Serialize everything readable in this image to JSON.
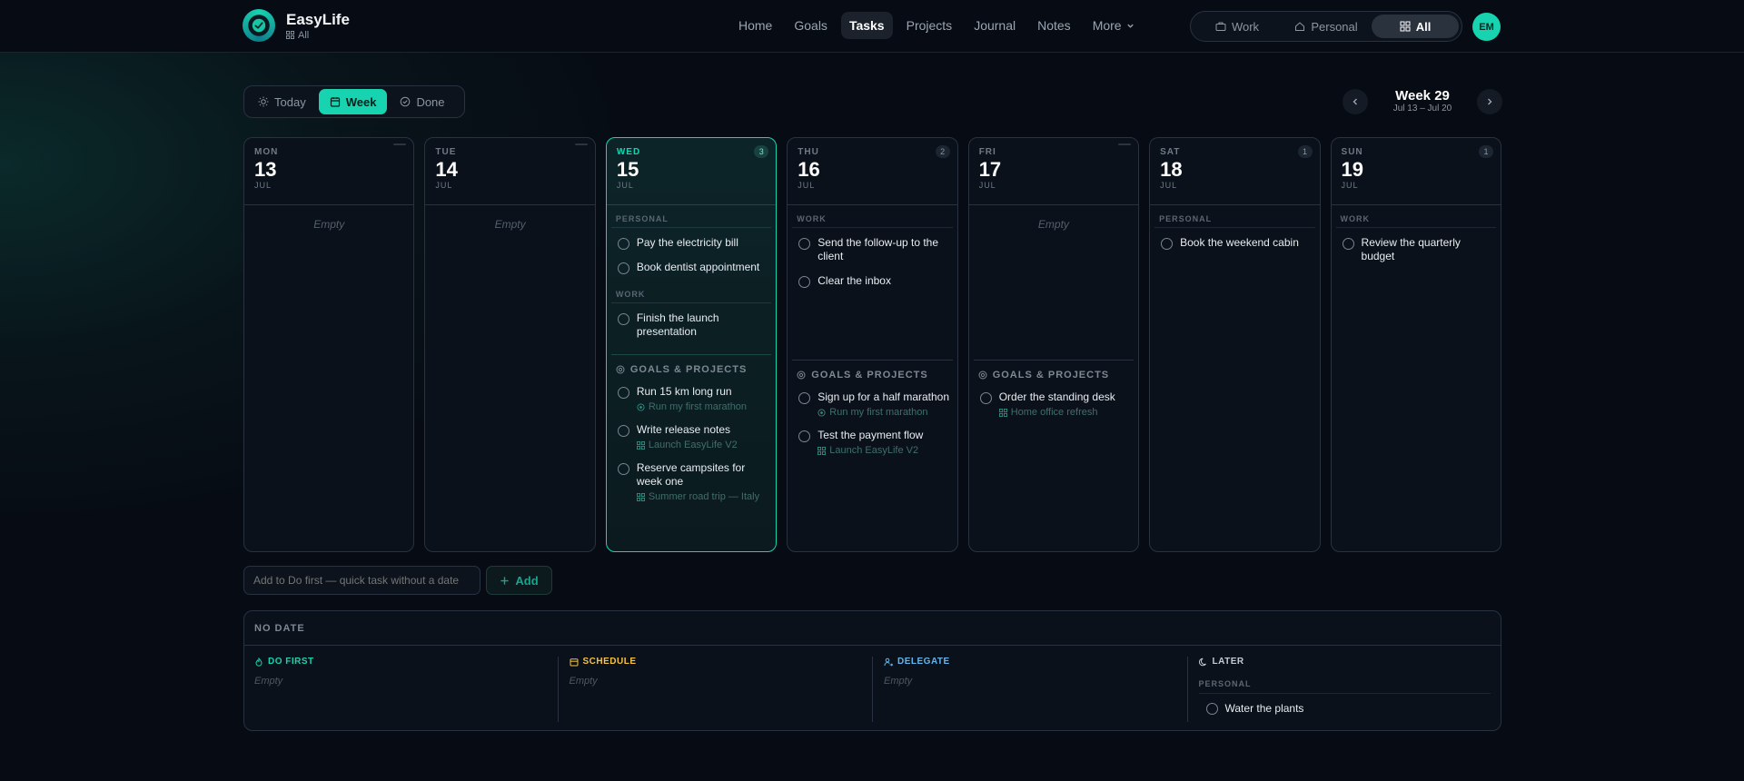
{
  "app": {
    "name": "EasyLife",
    "scope_label": "All"
  },
  "nav": [
    {
      "label": "Home"
    },
    {
      "label": "Goals"
    },
    {
      "label": "Tasks",
      "active": true
    },
    {
      "label": "Projects"
    },
    {
      "label": "Journal"
    },
    {
      "label": "Notes"
    },
    {
      "label": "More"
    }
  ],
  "scope": {
    "work": "Work",
    "personal": "Personal",
    "all": "All"
  },
  "user": {
    "initials": "EM"
  },
  "view": {
    "today": "Today",
    "week": "Week",
    "done": "Done"
  },
  "week": {
    "title": "Week 29",
    "range": "Jul 13 – Jul 20"
  },
  "days": {
    "mon": {
      "dow": "MON",
      "num": "13",
      "mon": "JUL",
      "empty": "Empty"
    },
    "tue": {
      "dow": "TUE",
      "num": "14",
      "mon": "JUL",
      "empty": "Empty"
    },
    "wed": {
      "dow": "WED",
      "num": "15",
      "mon": "JUL",
      "count": "3",
      "personal_label": "PERSONAL",
      "personal": [
        "Pay the electricity bill",
        "Book dentist appointment"
      ],
      "work_label": "WORK",
      "work": [
        "Finish the launch presentation"
      ],
      "gp_label": "GOALS & PROJECTS",
      "gp": [
        {
          "title": "Run 15 km long run",
          "sub": "Run my first marathon"
        },
        {
          "title": "Write release notes",
          "sub": "Launch EasyLife V2"
        },
        {
          "title": "Reserve campsites for week one",
          "sub": "Summer road trip — Italy"
        }
      ]
    },
    "thu": {
      "dow": "THU",
      "num": "16",
      "mon": "JUL",
      "count": "2",
      "work_label": "WORK",
      "work": [
        "Send the follow-up to the client",
        "Clear the inbox"
      ],
      "gp_label": "GOALS & PROJECTS",
      "gp": [
        {
          "title": "Sign up for a half marathon",
          "sub": "Run my first marathon"
        },
        {
          "title": "Test the payment flow",
          "sub": "Launch EasyLife V2"
        }
      ]
    },
    "fri": {
      "dow": "FRI",
      "num": "17",
      "mon": "JUL",
      "empty": "Empty",
      "gp_label": "GOALS & PROJECTS",
      "gp": [
        {
          "title": "Order the standing desk",
          "sub": "Home office refresh"
        }
      ]
    },
    "sat": {
      "dow": "SAT",
      "num": "18",
      "mon": "JUL",
      "count": "1",
      "personal_label": "PERSONAL",
      "personal": [
        "Book the weekend cabin"
      ]
    },
    "sun": {
      "dow": "SUN",
      "num": "19",
      "mon": "JUL",
      "count": "1",
      "work_label": "WORK",
      "work": [
        "Review the quarterly budget"
      ]
    }
  },
  "quick_add": {
    "placeholder": "Add to Do first — quick task without a date",
    "button": "Add"
  },
  "no_date": {
    "title": "NO DATE",
    "do_first": {
      "label": "DO FIRST",
      "empty": "Empty",
      "color": "#17d3b0"
    },
    "schedule": {
      "label": "SCHEDULE",
      "empty": "Empty",
      "color": "#f5c242"
    },
    "delegate": {
      "label": "DELEGATE",
      "empty": "Empty",
      "color": "#5fb6f0"
    },
    "later": {
      "label": "LATER",
      "section": "PERSONAL",
      "task": "Water the plants",
      "color": "#c3cbd4"
    }
  },
  "colors": {
    "accent": "#17d3b0",
    "background": "#070c14",
    "card": "#0b111a"
  }
}
